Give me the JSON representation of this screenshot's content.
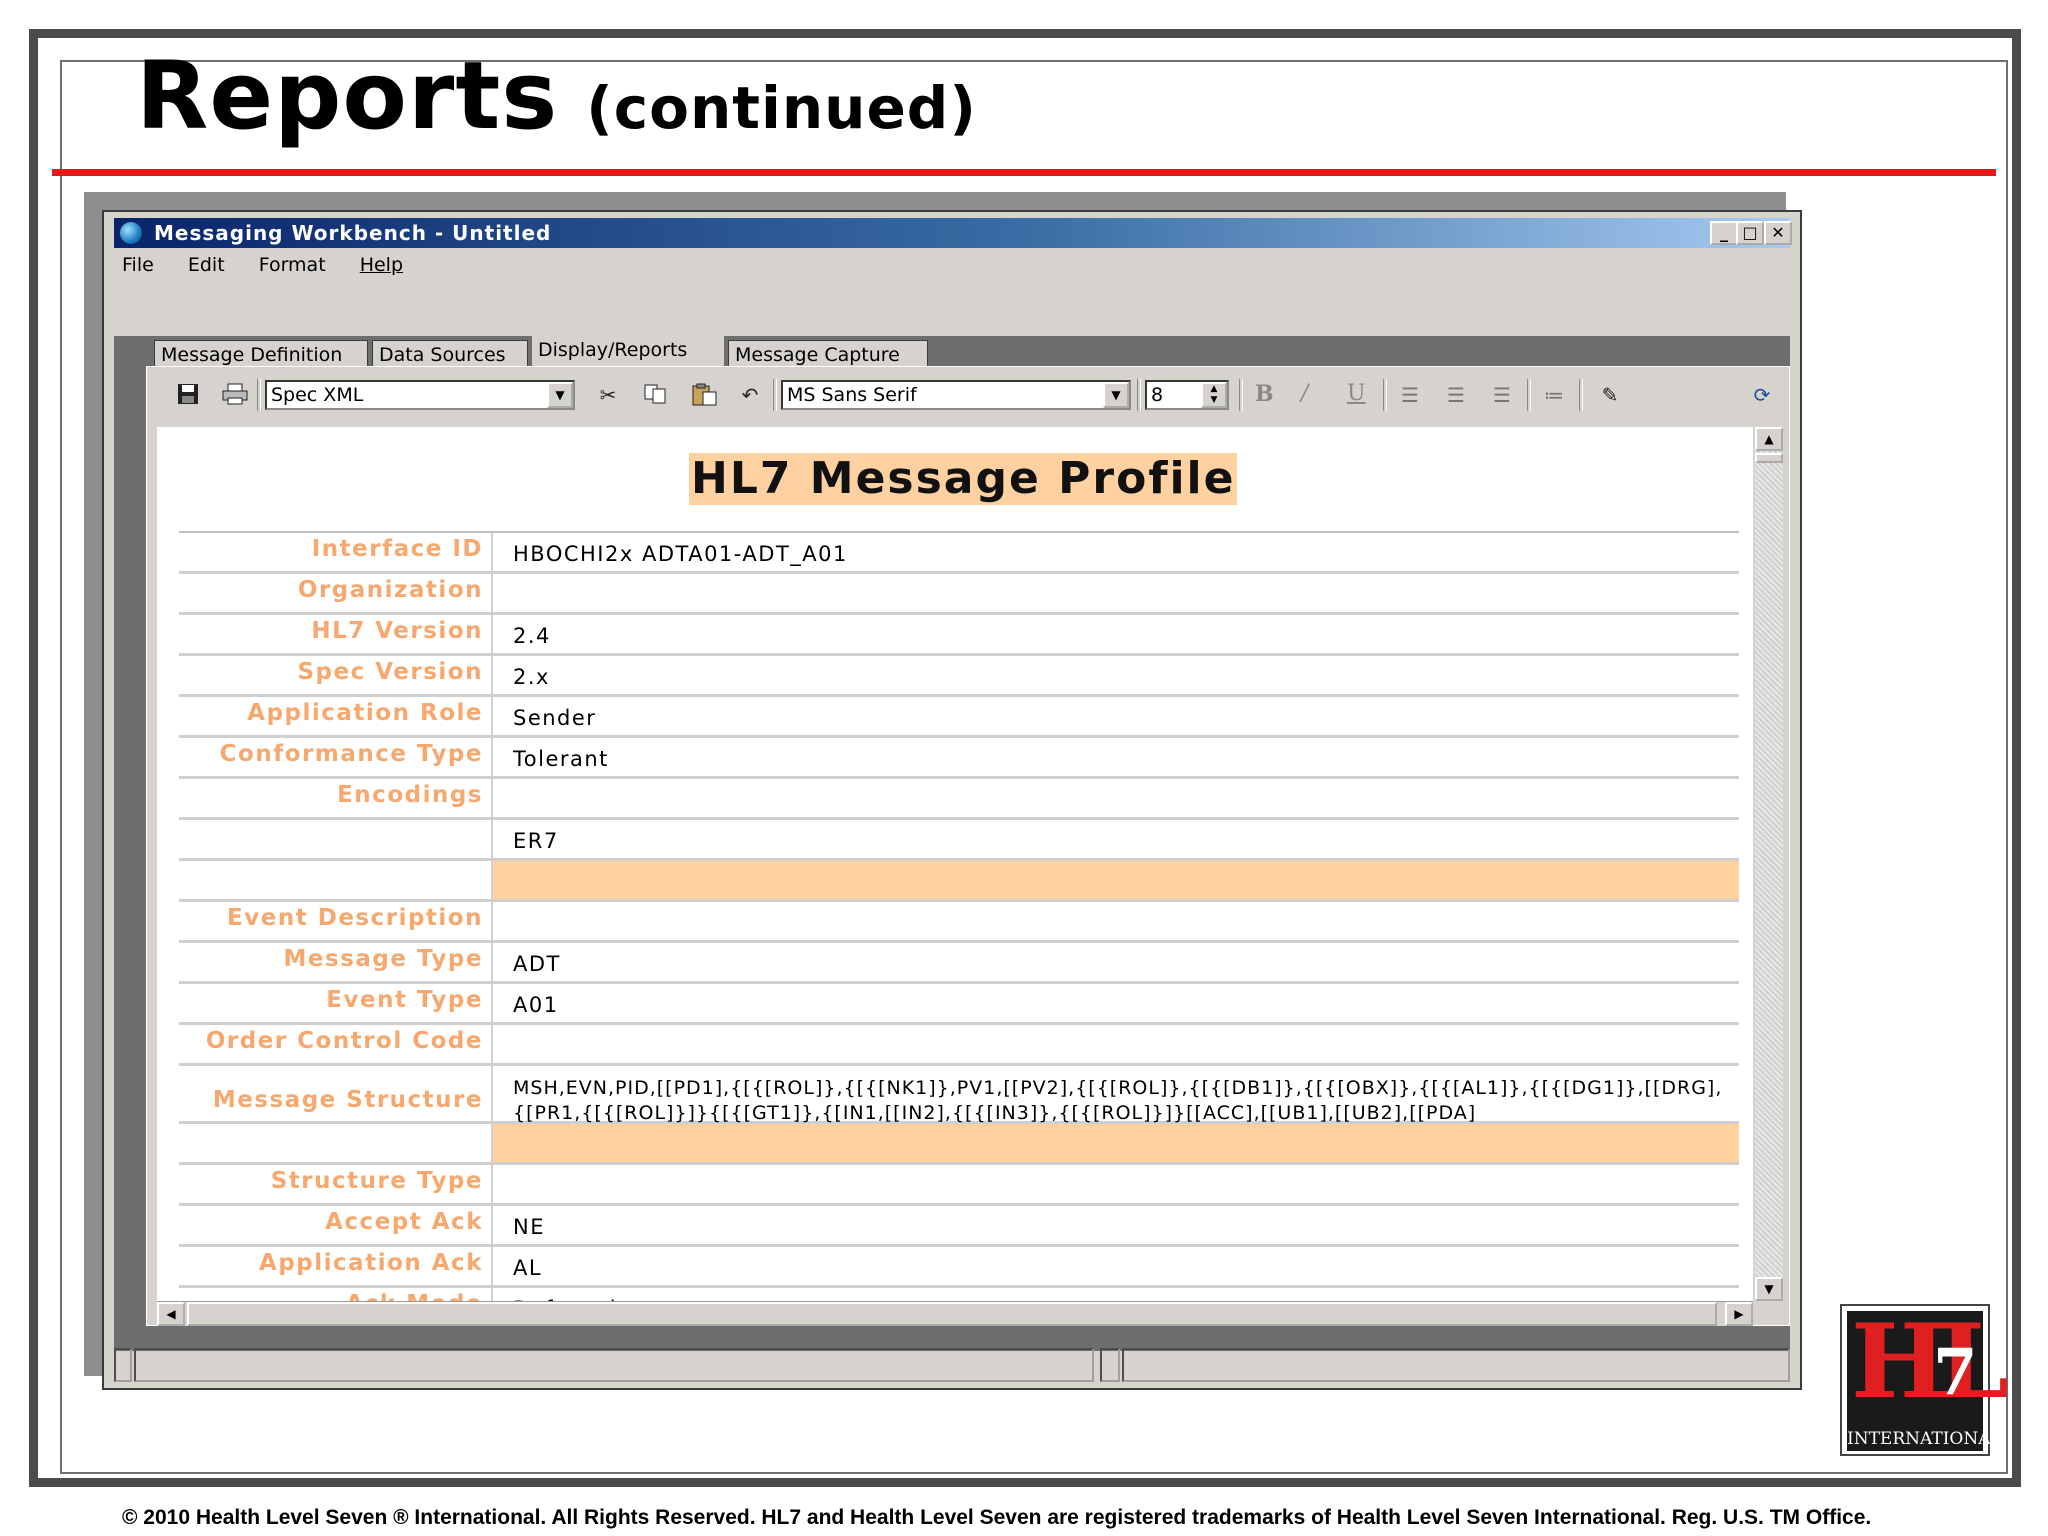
{
  "slide": {
    "title": "Reports",
    "title_suffix": "(continued)",
    "footer": "© 2010 Health Level Seven ® International. All Rights Reserved. HL7 and Health Level Seven are registered trademarks of Health Level Seven International. Reg. U.S. TM Office.",
    "logo_text": "INTERNATIONAL",
    "logo_mark": "HL",
    "logo_seven": "7",
    "accent_color": "#e61919"
  },
  "window": {
    "title": "Messaging Workbench - Untitled",
    "menu": [
      "File",
      "Edit",
      "Format",
      "Help"
    ],
    "tabs": [
      "Message Definition",
      "Data Sources",
      "Display/Reports",
      "Message Capture"
    ],
    "active_tab": "Display/Reports"
  },
  "toolbar": {
    "report_combo": "Spec XML",
    "font_combo": "MS Sans Serif",
    "font_size": "8",
    "icons": [
      "save-icon",
      "print-icon",
      "cut-icon",
      "copy-icon",
      "paste-icon",
      "undo-icon",
      "bold-icon",
      "italic-icon",
      "underline-icon",
      "align-left-icon",
      "align-center-icon",
      "align-right-icon",
      "bullets-icon",
      "edit-icon",
      "refresh-icon"
    ]
  },
  "report": {
    "heading": "HL7 Message Profile",
    "highlight_color": "#ffd0a0",
    "label_color": "#f7a86f",
    "rows": [
      {
        "label": "Interface ID",
        "value": "HBOCHI2x ADTA01-ADT_A01"
      },
      {
        "label": "Organization",
        "value": ""
      },
      {
        "label": "HL7 Version",
        "value": "2.4"
      },
      {
        "label": "Spec Version",
        "value": "2.x"
      },
      {
        "label": "Application Role",
        "value": "Sender"
      },
      {
        "label": "Conformance Type",
        "value": "Tolerant"
      },
      {
        "label": "Encodings",
        "value": ""
      },
      {
        "label": "",
        "value": "ER7"
      },
      {
        "label": "",
        "value": ""
      },
      {
        "label": "Event Description",
        "value": ""
      },
      {
        "label": "Message Type",
        "value": "ADT"
      },
      {
        "label": "Event Type",
        "value": "A01"
      },
      {
        "label": "Order Control Code",
        "value": ""
      },
      {
        "label": "Message Structure",
        "value": "MSH,EVN,PID,[[PD1],{[{[ROL]},{[{[NK1]},PV1,[[PV2],{[{[ROL]},{[{[DB1]},{[{[OBX]},{[{[AL1]},{[{[DG1]},[[DRG],{[PR1,{[{[ROL]}]}{[{[GT1]},{[IN1,[[IN2],{[{[IN3]},{[{[ROL]}]}[[ACC],[[UB1],[[UB2],[[PDA]"
      },
      {
        "label": "",
        "value": ""
      },
      {
        "label": "Structure Type",
        "value": ""
      },
      {
        "label": "Accept Ack",
        "value": "NE"
      },
      {
        "label": "Application Ack",
        "value": "AL"
      },
      {
        "label": "Ack Mode",
        "value": "Deferred"
      }
    ]
  }
}
